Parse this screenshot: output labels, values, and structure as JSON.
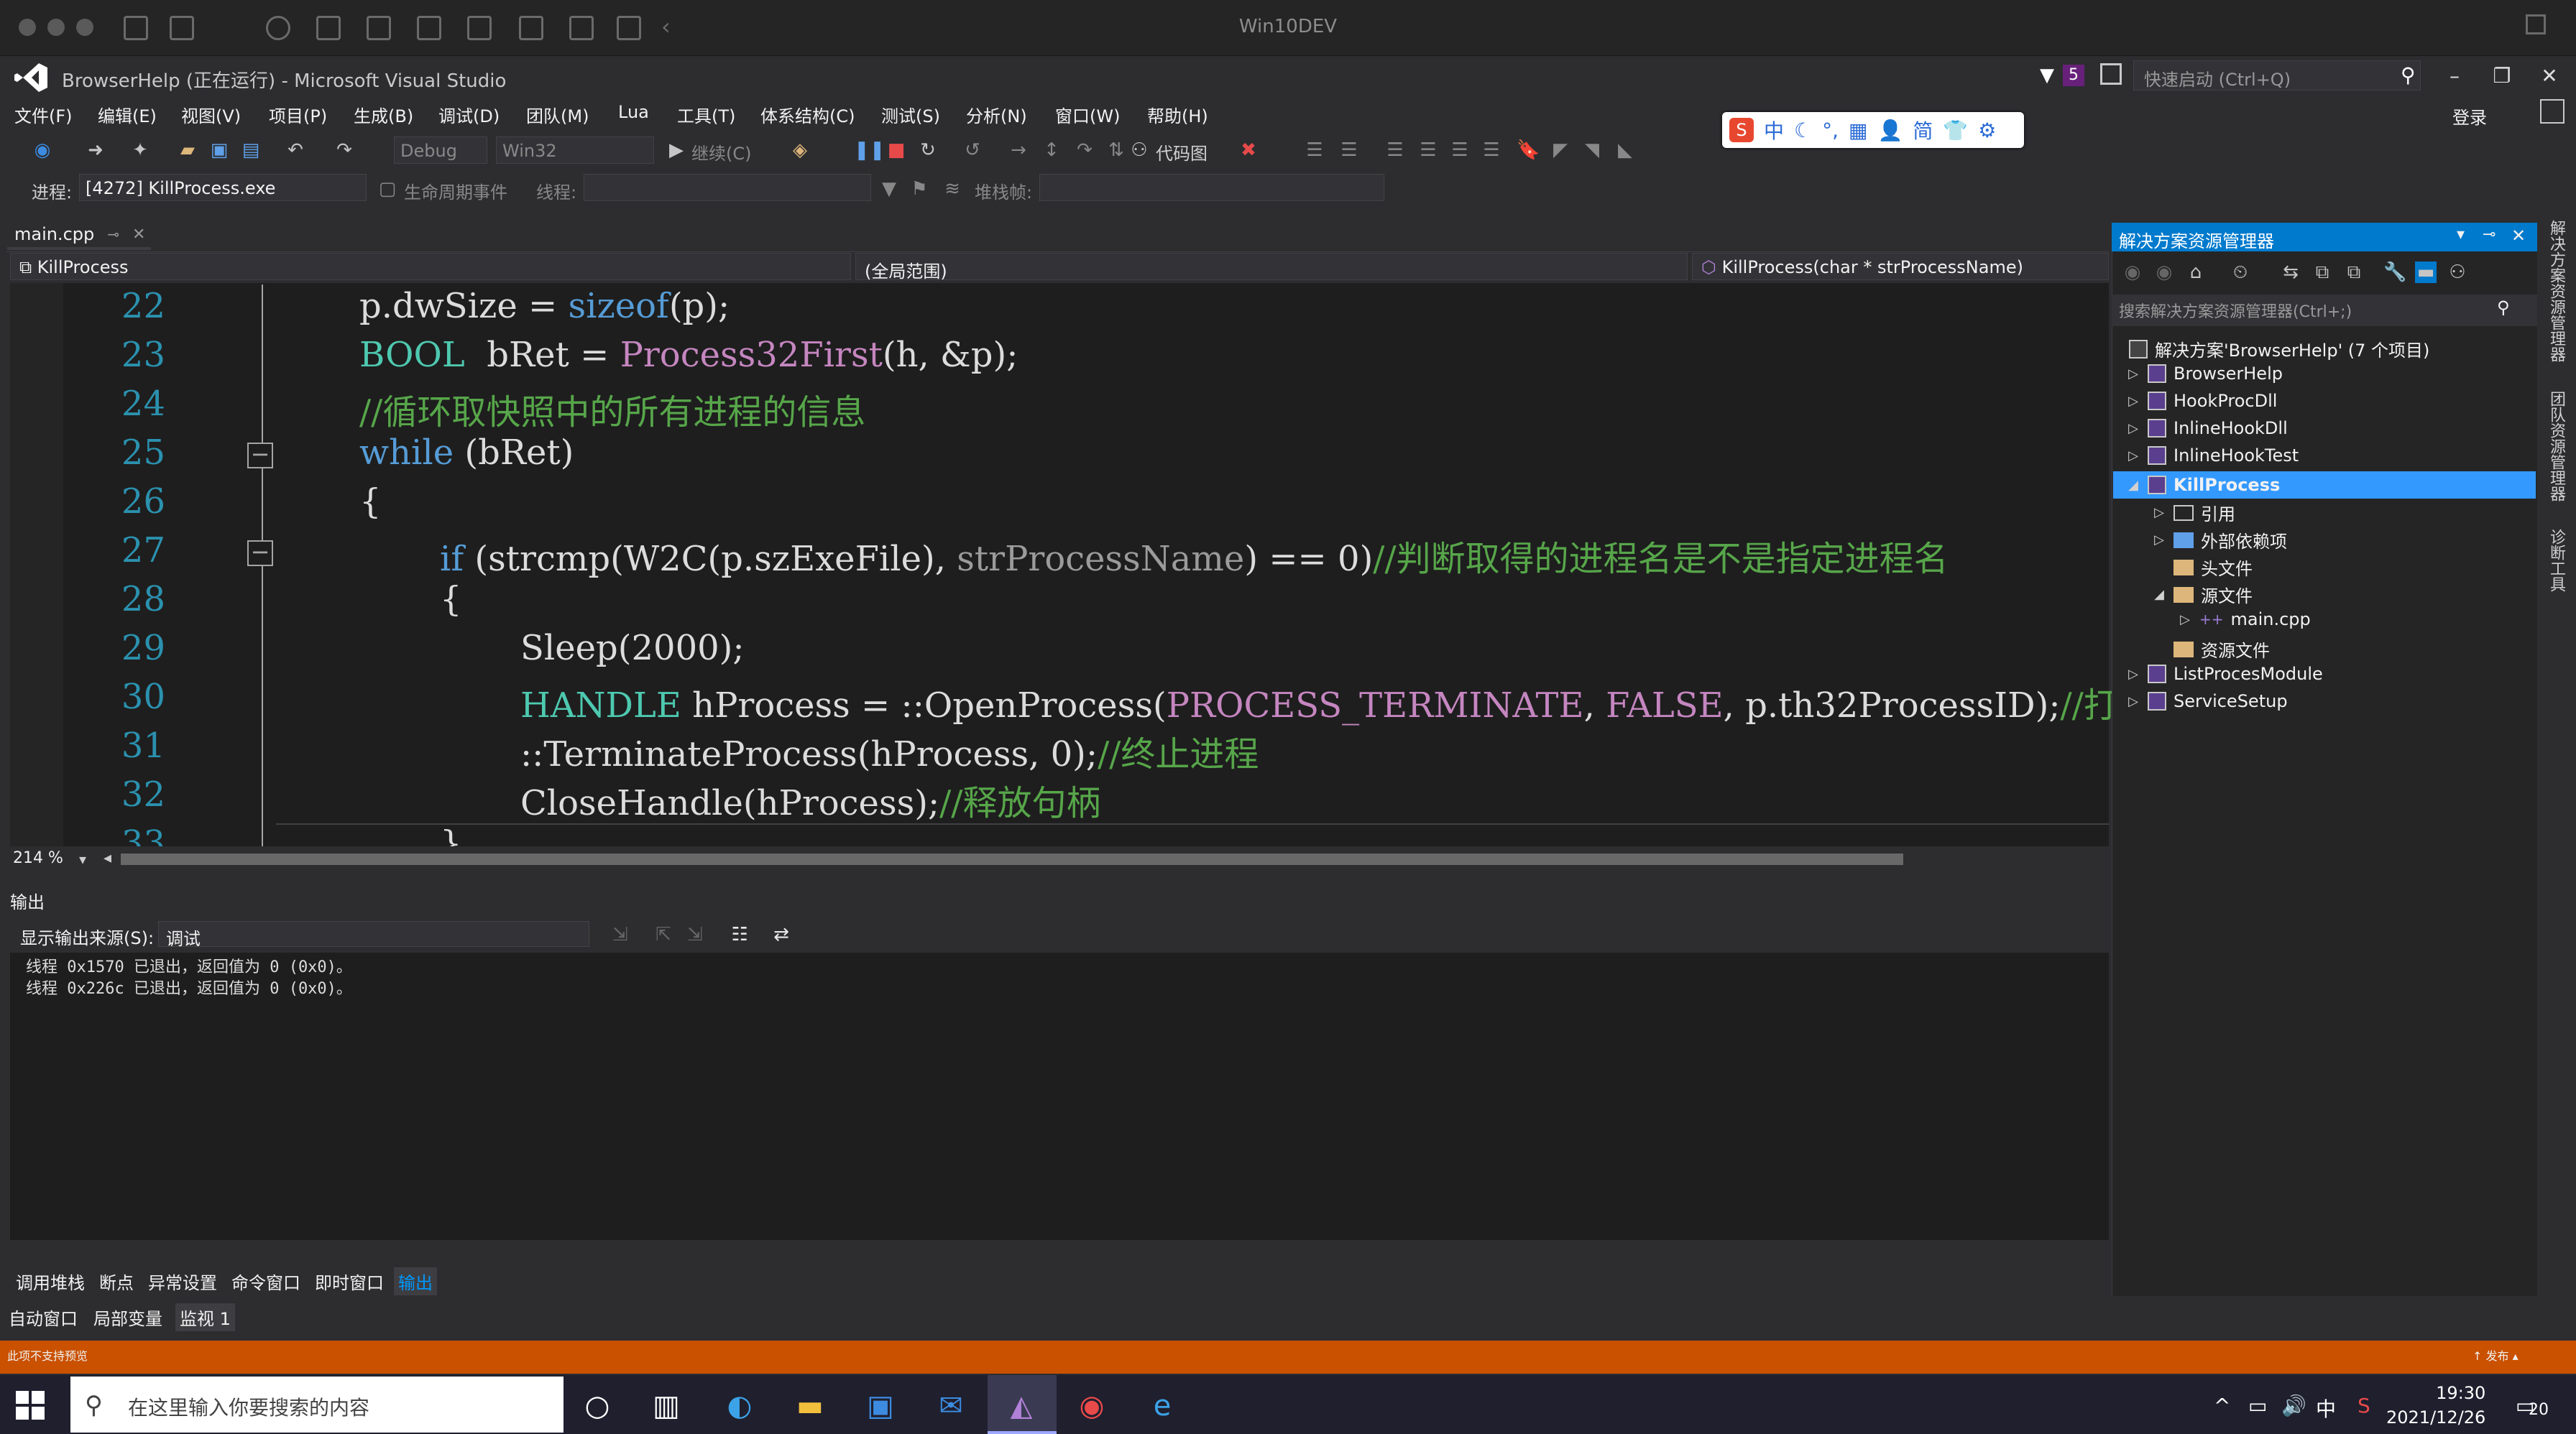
{
  "mac": {
    "title": "Win10DEV"
  },
  "vs": {
    "title": "BrowserHelp (正在运行) - Microsoft Visual Studio",
    "notif_count": "5",
    "quick_launch_placeholder": "快速启动 (Ctrl+Q)",
    "login": "登录"
  },
  "menu": [
    "文件(F)",
    "编辑(E)",
    "视图(V)",
    "项目(P)",
    "生成(B)",
    "调试(D)",
    "团队(M)",
    "Lua",
    "工具(T)",
    "体系结构(C)",
    "测试(S)",
    "分析(N)",
    "窗口(W)",
    "帮助(H)"
  ],
  "ime": {
    "lang": "中",
    "simplified": "简"
  },
  "toolbar": {
    "config": "Debug",
    "platform": "Win32",
    "continue": "继续(C)",
    "codemap": "代码图",
    "process_label": "进程:",
    "process_value": "[4272] KillProcess.exe",
    "lifecycle": "生命周期事件",
    "thread_label": "线程:",
    "stack_label": "堆栈帧:"
  },
  "editor": {
    "tab": "main.cpp",
    "nav_project": "KillProcess",
    "nav_scope": "(全局范围)",
    "nav_func": "KillProcess(char * strProcessName)",
    "zoom": "214 %",
    "line_numbers": [
      "22",
      "23",
      "24",
      "25",
      "26",
      "27",
      "28",
      "29",
      "30",
      "31",
      "32",
      "33"
    ]
  },
  "code": {
    "l22a": "p.dwSize = ",
    "l22b": "sizeof",
    "l22c": "(p);",
    "l23a": "BOOL",
    "l23b": "  bRet = ",
    "l23c": "Process32First",
    "l23d": "(h, &p);",
    "l24": "//循环取快照中的所有进程的信息",
    "l25a": "while",
    "l25b": " (bRet)",
    "l26": "{",
    "l27a": "if",
    "l27b": " (strcmp(W2C(p.szExeFile), ",
    "l27c": "strProcessName",
    "l27d": ") == 0)",
    "l27e": "//判断取得的进程名是不是指定进程名",
    "l28": "{",
    "l29": "Sleep(2000);",
    "l30a": "HANDLE",
    "l30b": " hProcess = ::OpenProcess(",
    "l30c": "PROCESS_TERMINATE",
    "l30d": ", ",
    "l30e": "FALSE",
    "l30f": ", p.th32ProcessID);",
    "l30g": "//打开",
    "l31a": "::TerminateProcess(hProcess, 0);",
    "l31b": "//终止进程",
    "l32a": "CloseHandle(hProcess);",
    "l32b": "//释放句柄",
    "l33": "}"
  },
  "output": {
    "header": "输出",
    "source_label": "显示输出来源(S):",
    "source_value": "调试",
    "lines": [
      "线程 0x1570 已退出，返回值为 0 (0x0)。",
      "线程 0x226c 已退出，返回值为 0 (0x0)。"
    ]
  },
  "bottom_tabs": [
    "调用堆栈",
    "断点",
    "异常设置",
    "命令窗口",
    "即时窗口",
    "输出"
  ],
  "bottom_tabs2": [
    "自动窗口",
    "局部变量",
    "监视 1"
  ],
  "solution": {
    "title": "解决方案资源管理器",
    "search": "搜索解决方案资源管理器(Ctrl+;)",
    "root": "解决方案'BrowserHelp' (7 个项目)",
    "items": [
      "BrowserHelp",
      "HookProcDll",
      "InlineHookDll",
      "InlineHookTest",
      "KillProcess",
      "引用",
      "外部依赖项",
      "头文件",
      "源文件",
      "main.cpp",
      "资源文件",
      "ListProcesModule",
      "ServiceSetup"
    ]
  },
  "side_labels": [
    "解决方案资源管理器",
    "团队资源管理器",
    "诊断工具"
  ],
  "status": {
    "left": "此项不支持预览",
    "right": "发布"
  },
  "taskbar": {
    "search": "在这里输入你要搜索的内容",
    "ime": "中",
    "time": "19:30",
    "date": "2021/12/26",
    "badge": "20"
  },
  "colors": {
    "accent": "#007acc",
    "status": "#ca5100",
    "keyword": "#569cd6",
    "comment": "#57a64a",
    "macro": "#c586c0",
    "type": "#4ec9b0"
  }
}
